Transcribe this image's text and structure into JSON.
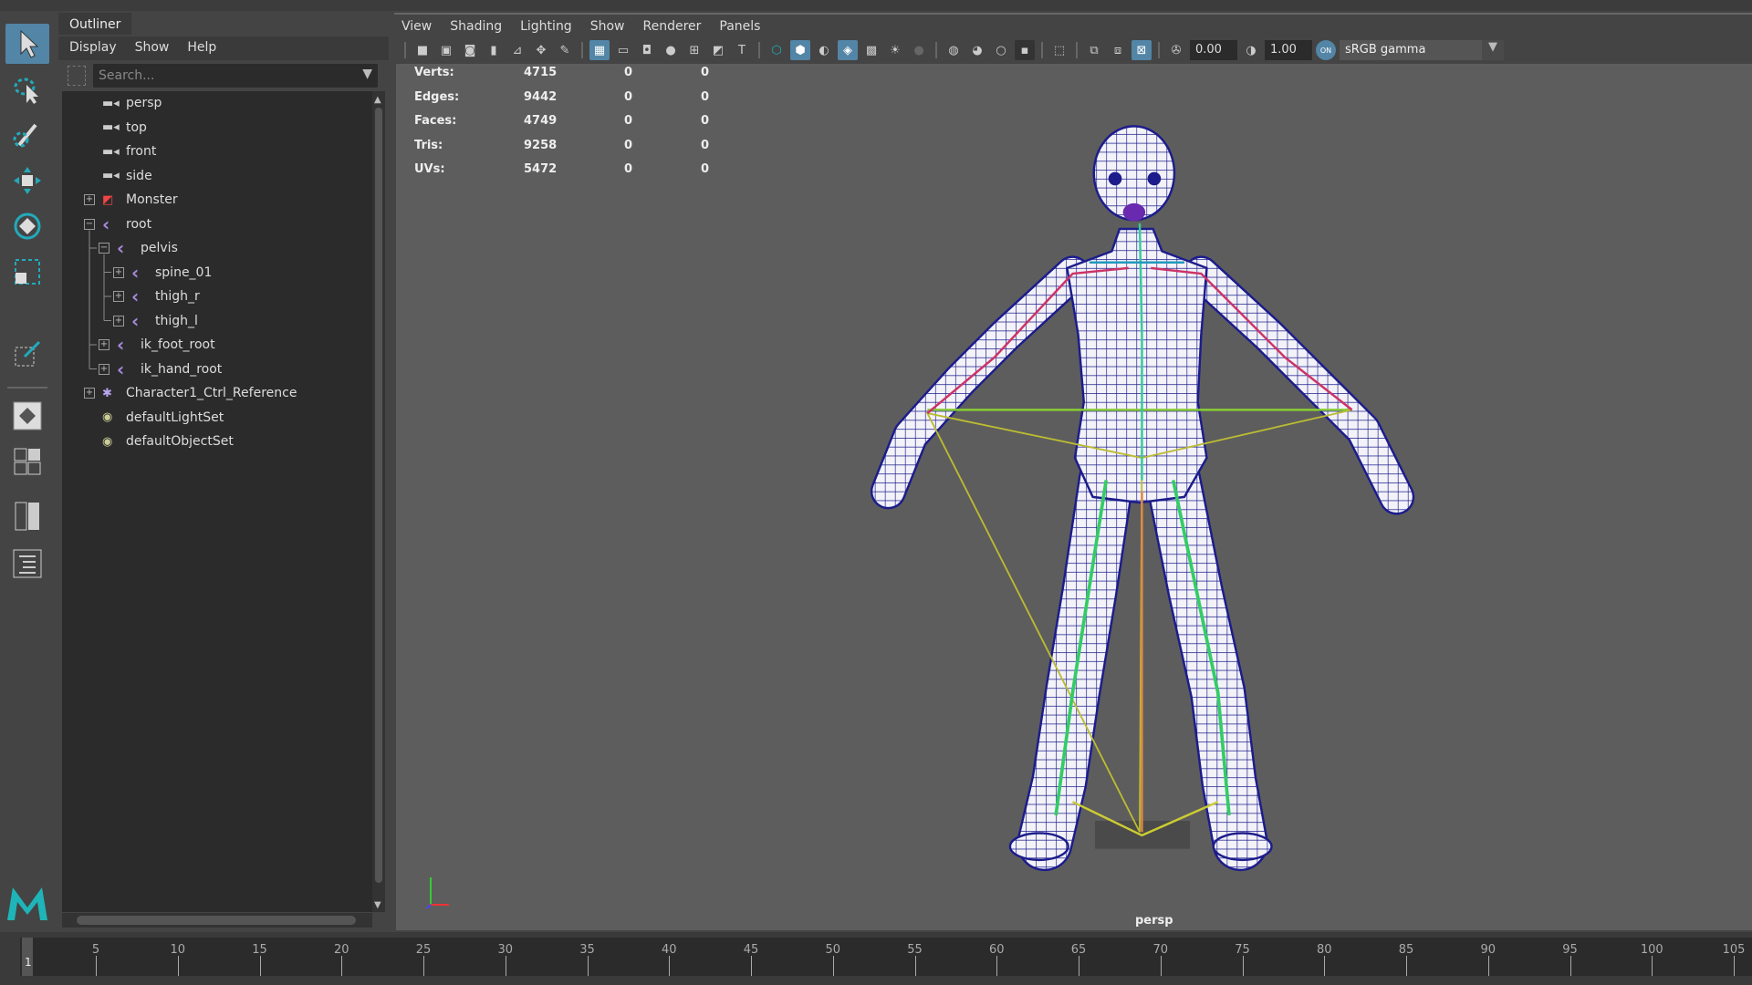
{
  "outliner": {
    "tab": "Outliner",
    "menu": [
      "Display",
      "Show",
      "Help"
    ],
    "search_placeholder": "Search...",
    "items": [
      {
        "label": "persp",
        "icon": "camera-icon",
        "depth": 0,
        "expander": ""
      },
      {
        "label": "top",
        "icon": "camera-icon",
        "depth": 0,
        "expander": ""
      },
      {
        "label": "front",
        "icon": "camera-icon",
        "depth": 0,
        "expander": ""
      },
      {
        "label": "side",
        "icon": "camera-icon",
        "depth": 0,
        "expander": ""
      },
      {
        "label": "Monster",
        "icon": "mesh-icon",
        "depth": 0,
        "expander": "+"
      },
      {
        "label": "root",
        "icon": "joint-icon",
        "depth": 0,
        "expander": "-"
      },
      {
        "label": "pelvis",
        "icon": "joint-icon",
        "depth": 1,
        "expander": "-"
      },
      {
        "label": "spine_01",
        "icon": "joint-icon",
        "depth": 2,
        "expander": "+"
      },
      {
        "label": "thigh_r",
        "icon": "joint-icon",
        "depth": 2,
        "expander": "+"
      },
      {
        "label": "thigh_l",
        "icon": "joint-icon",
        "depth": 2,
        "expander": "+"
      },
      {
        "label": "ik_foot_root",
        "icon": "joint-icon",
        "depth": 1,
        "expander": "+"
      },
      {
        "label": "ik_hand_root",
        "icon": "joint-icon",
        "depth": 1,
        "expander": "+"
      },
      {
        "label": "Character1_Ctrl_Reference",
        "icon": "character-icon",
        "depth": 0,
        "expander": "+"
      },
      {
        "label": "defaultLightSet",
        "icon": "set-icon",
        "depth": 0,
        "expander": ""
      },
      {
        "label": "defaultObjectSet",
        "icon": "set-icon",
        "depth": 0,
        "expander": ""
      }
    ]
  },
  "viewport": {
    "menu": [
      "View",
      "Shading",
      "Lighting",
      "Show",
      "Renderer",
      "Panels"
    ],
    "exposure": "0.00",
    "gamma": "1.00",
    "color_management": "sRGB gamma",
    "cm_toggle": "ON",
    "camera_label": "persp",
    "stats": [
      {
        "label": "Verts:",
        "values": [
          "4715",
          "0",
          "0"
        ]
      },
      {
        "label": "Edges:",
        "values": [
          "9442",
          "0",
          "0"
        ]
      },
      {
        "label": "Faces:",
        "values": [
          "4749",
          "0",
          "0"
        ]
      },
      {
        "label": "Tris:",
        "values": [
          "9258",
          "0",
          "0"
        ]
      },
      {
        "label": "UVs:",
        "values": [
          "5472",
          "0",
          "0"
        ]
      }
    ]
  },
  "timeline": {
    "current_frame": "1",
    "labels": [
      "5",
      "10",
      "15",
      "20",
      "25",
      "30",
      "35",
      "40",
      "45",
      "50",
      "55",
      "60",
      "65",
      "70",
      "75",
      "80",
      "85",
      "90",
      "95",
      "100",
      "105"
    ]
  },
  "colors": {
    "accent": "#5285a6",
    "mesh_line": "#1c1c8c",
    "viewport_bg": "#5d5d5d"
  }
}
